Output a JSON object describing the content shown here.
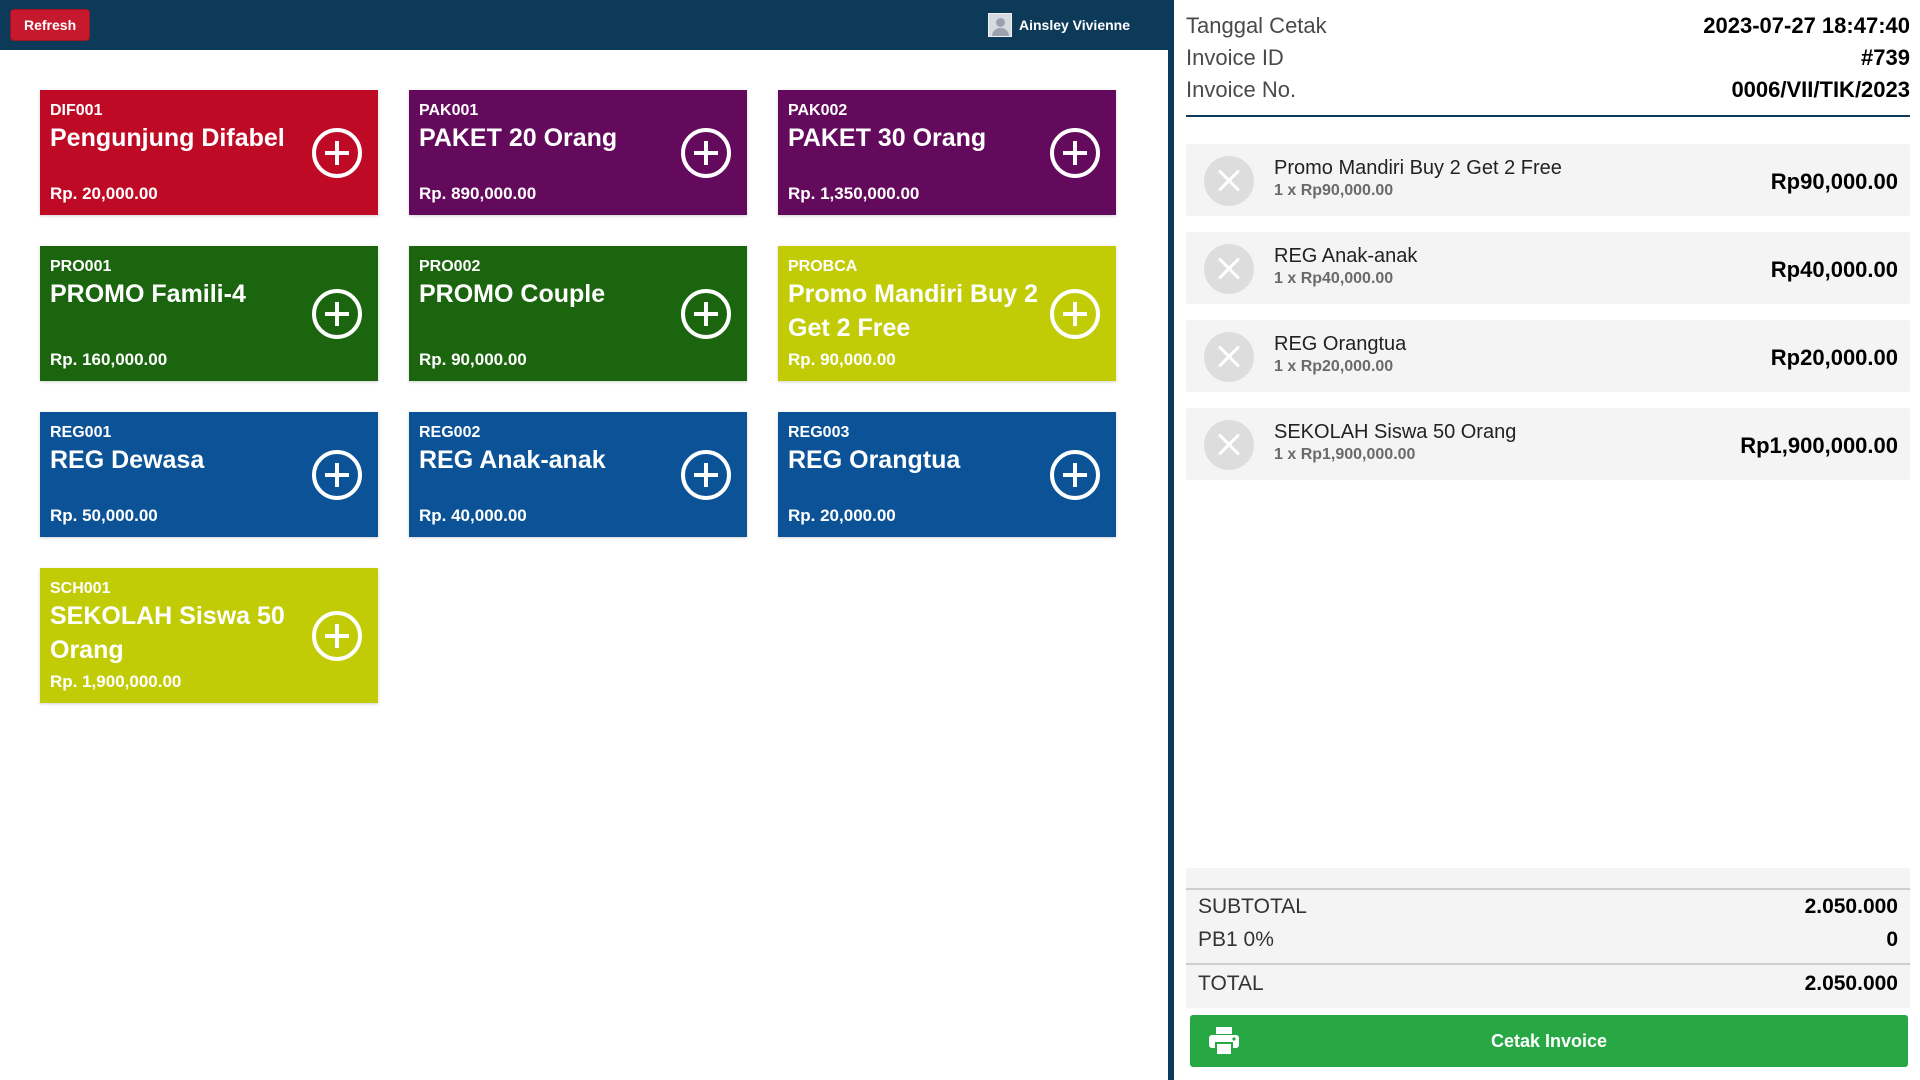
{
  "header": {
    "refresh_label": "Refresh",
    "user_name": "Ainsley Vivienne"
  },
  "products": [
    {
      "code": "DIF001",
      "name": "Pengunjung Difabel",
      "price": "Rp. 20,000.00",
      "color": "#bf0a26"
    },
    {
      "code": "PAK001",
      "name": "PAKET 20 Orang",
      "price": "Rp. 890,000.00",
      "color": "#640a5c"
    },
    {
      "code": "PAK002",
      "name": "PAKET 30 Orang",
      "price": "Rp. 1,350,000.00",
      "color": "#640a5c"
    },
    {
      "code": "PRO001",
      "name": "PROMO Famili-4",
      "price": "Rp. 160,000.00",
      "color": "#1b650e"
    },
    {
      "code": "PRO002",
      "name": "PROMO Couple",
      "price": "Rp. 90,000.00",
      "color": "#1b650e"
    },
    {
      "code": "PROBCA",
      "name": "Promo Mandiri Buy 2 Get 2 Free",
      "price": "Rp. 90,000.00",
      "color": "#c1cc06"
    },
    {
      "code": "REG001",
      "name": "REG Dewasa",
      "price": "Rp. 50,000.00",
      "color": "#0b5297"
    },
    {
      "code": "REG002",
      "name": "REG Anak-anak",
      "price": "Rp. 40,000.00",
      "color": "#0b5297"
    },
    {
      "code": "REG003",
      "name": "REG Orangtua",
      "price": "Rp. 20,000.00",
      "color": "#0b5297"
    },
    {
      "code": "SCH001",
      "name": "SEKOLAH Siswa 50 Orang",
      "price": "Rp. 1,900,000.00",
      "color": "#c1cc06"
    }
  ],
  "invoice": {
    "print_date_label": "Tanggal Cetak",
    "print_date": "2023-07-27 18:47:40",
    "id_label": "Invoice ID",
    "id": "#739",
    "no_label": "Invoice No.",
    "no": "0006/VII/TIK/2023"
  },
  "cart": [
    {
      "name": "Promo Mandiri Buy 2 Get 2 Free",
      "qty": "1 x Rp90,000.00",
      "total": "Rp90,000.00"
    },
    {
      "name": "REG Anak-anak",
      "qty": "1 x Rp40,000.00",
      "total": "Rp40,000.00"
    },
    {
      "name": "REG Orangtua",
      "qty": "1 x Rp20,000.00",
      "total": "Rp20,000.00"
    },
    {
      "name": "SEKOLAH Siswa 50 Orang",
      "qty": "1 x Rp1,900,000.00",
      "total": "Rp1,900,000.00"
    }
  ],
  "summary": {
    "subtotal_label": "SUBTOTAL",
    "subtotal": "2.050.000",
    "tax_label": "PB1 0%",
    "tax": "0",
    "total_label": "TOTAL",
    "total": "2.050.000"
  },
  "print_button": {
    "label": "Cetak Invoice",
    "icon": "printer-icon"
  },
  "colors": {
    "topbar": "#0e3a5a",
    "refresh": "#c7192d",
    "print": "#27a845"
  }
}
